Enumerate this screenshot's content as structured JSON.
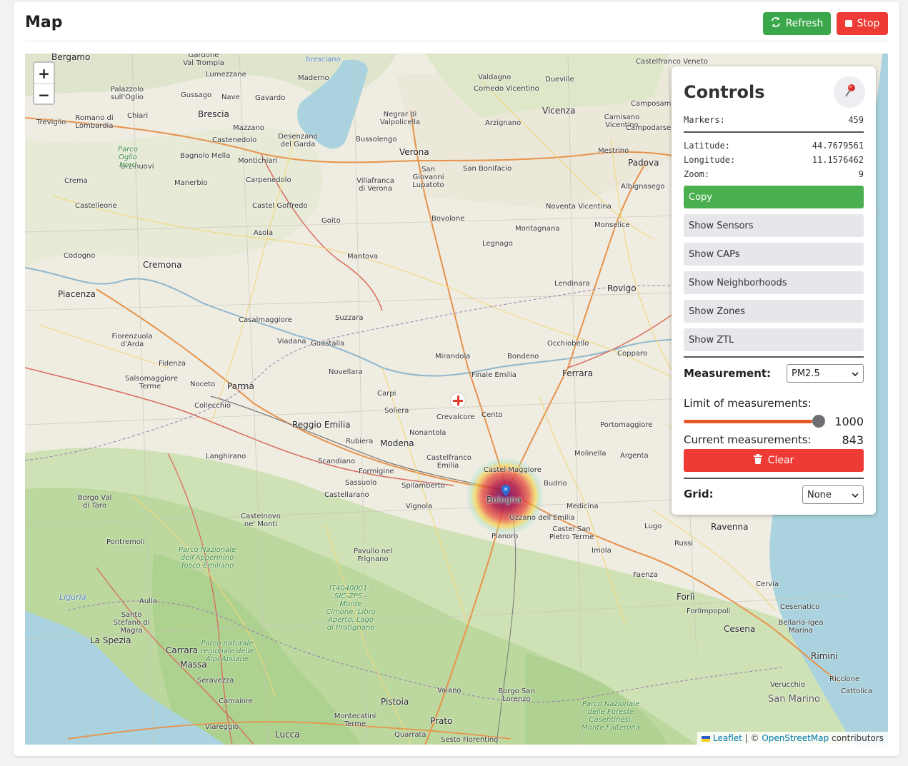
{
  "header": {
    "title": "Map",
    "refresh_label": "Refresh",
    "stop_label": "Stop"
  },
  "map": {
    "zoom_in": "+",
    "zoom_out": "−",
    "attribution": {
      "leaflet": "Leaflet",
      "separator": " | © ",
      "osm": "OpenStreetMap",
      "contributors": " contributors"
    },
    "place_labels": [
      "Bergamo",
      "Gardone Val Trompia",
      "bresciano",
      "Maderno",
      "Lumezzane",
      "Palazzolo sull'Oglio",
      "Gussago",
      "Nave",
      "Gavardo",
      "Brescia",
      "Chiari",
      "Romano di Lombardia",
      "Treviglio",
      "Mazzano",
      "Desenzano del Garda",
      "Castenedolo",
      "Montichiari",
      "Bagnolo Mella",
      "Orzinuovi",
      "Parco Oglio Nord",
      "Manerbio",
      "Crema",
      "Carpenedolo",
      "Castelleone",
      "Castel Goffredo",
      "Asola",
      "Goito",
      "Codogno",
      "Cremona",
      "Piacenza",
      "Casalmaggiore",
      "Viadana",
      "Guastalla",
      "Suzzara",
      "Mantova",
      "Fiorenzuola d'Arda",
      "Fidenza",
      "Salsomaggiore Terme",
      "Noceto",
      "Parma",
      "Collecchio",
      "Novellara",
      "Reggio Emilia",
      "Rubiera",
      "Modena",
      "Carpi",
      "Soliera",
      "Mirandola",
      "Bondeno",
      "Finale Emilia",
      "Crevalcore",
      "Cento",
      "Ferrara",
      "Nonantola",
      "Castelfranco Emilia",
      "Scandiano",
      "Formigine",
      "Sassuolo",
      "Castellarano",
      "Spilamberto",
      "Vignola",
      "Castel Maggiore",
      "Bologna",
      "Budrio",
      "Ozzano dell'Emilia",
      "Medicina",
      "Castel San Pietro Terme",
      "Pianoro",
      "Imola",
      "Langhirano",
      "Borgo Val di Taro",
      "Castelnovo ne' Monti",
      "Pontremoli",
      "Parco Nazionale dell'Appennino Tosco-Emiliano",
      "Pavullo nel Frignano",
      "Aulla",
      "Santo Stefano di Magra",
      "La Spezia",
      "Liguria",
      "Carrara",
      "Massa",
      "Seravezza",
      "Camaiore",
      "Viareggio",
      "Lucca",
      "Pistoia",
      "Prato",
      "Montecatini Terme",
      "Quarrata",
      "Vaiano",
      "Borgo San Lorenzo",
      "Sesto Fiorentino",
      "Verona",
      "San Giovanni Lupatoto",
      "San Bonifacio",
      "Villafranca di Verona",
      "Bussolengo",
      "Negrar di Valpolicella",
      "Valdagno",
      "Cornedo Vicentino",
      "Arzignano",
      "Vicenza",
      "Dueville",
      "Camisano Vicentino",
      "Campodarsego",
      "Padova",
      "Mestrino",
      "Albignasego",
      "Bovolone",
      "Noventa Vicentina",
      "Montagnana",
      "Monselice",
      "Legnago",
      "Lendinara",
      "Rovigo",
      "Occhiobello",
      "Copparo",
      "Portomaggiore",
      "Molinella",
      "Argenta",
      "Lugo",
      "Ravenna",
      "Russi",
      "Faenza",
      "Forlì",
      "Forlimpopoli",
      "Cesena",
      "Cervia",
      "Cesenatico",
      "Bellaria-Igea Marina",
      "Rimini",
      "Riccione",
      "Cattolica",
      "San Marino",
      "Verucchio",
      "Parco Nazionale delle Foreste Casentinesi, Monte Falterona",
      "IT4040001 - SIC-ZPS - Monte Cimone, Libro Aperto, Lago di Pratignano",
      "Parco naturale regionale delle Alpi Apuane",
      "Castelfranco Veneto",
      "Camposampiero"
    ]
  },
  "controls": {
    "title": "Controls",
    "markers_label": "Markers:",
    "markers_value": "459",
    "latitude_label": "Latitude:",
    "latitude_value": "44.7679561",
    "longitude_label": "Longitude:",
    "longitude_value": "11.1576462",
    "zoom_label": "Zoom:",
    "zoom_value": "9",
    "copy_label": "Copy",
    "show_buttons": [
      "Show Sensors",
      "Show CAPs",
      "Show Neighborhoods",
      "Show Zones",
      "Show ZTL"
    ],
    "measurement_label": "Measurement:",
    "measurement_value": "PM2.5",
    "limit_label": "Limit of measurements:",
    "limit_value": "1000",
    "current_label": "Current measurements:",
    "current_value": "843",
    "clear_label": "Clear",
    "grid_label": "Grid:",
    "grid_value": "None"
  },
  "colors": {
    "refresh": "#3aa84a",
    "stop": "#ef3b35",
    "copy": "#4ab04f",
    "clear": "#ef3b35",
    "slider": "#e25a28"
  }
}
